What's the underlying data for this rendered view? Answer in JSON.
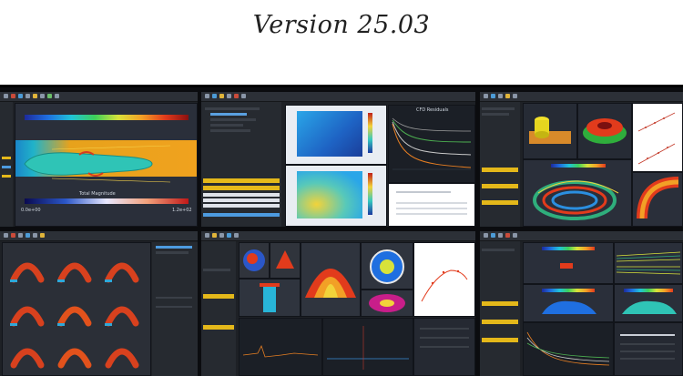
{
  "header": {
    "title": "Version 25.03"
  },
  "panel1": {
    "colorbar_title": "Total Magnitude",
    "left_tick": "0.0e+00",
    "right_tick": "1.2e+02"
  },
  "panel2": {
    "chart_title": "CFD Residuals"
  },
  "colors": {
    "app_bg": "#1e2126",
    "toolbar": "#2c3037",
    "highlight": "#e4b81a",
    "plot_bg": "#ffffff"
  }
}
